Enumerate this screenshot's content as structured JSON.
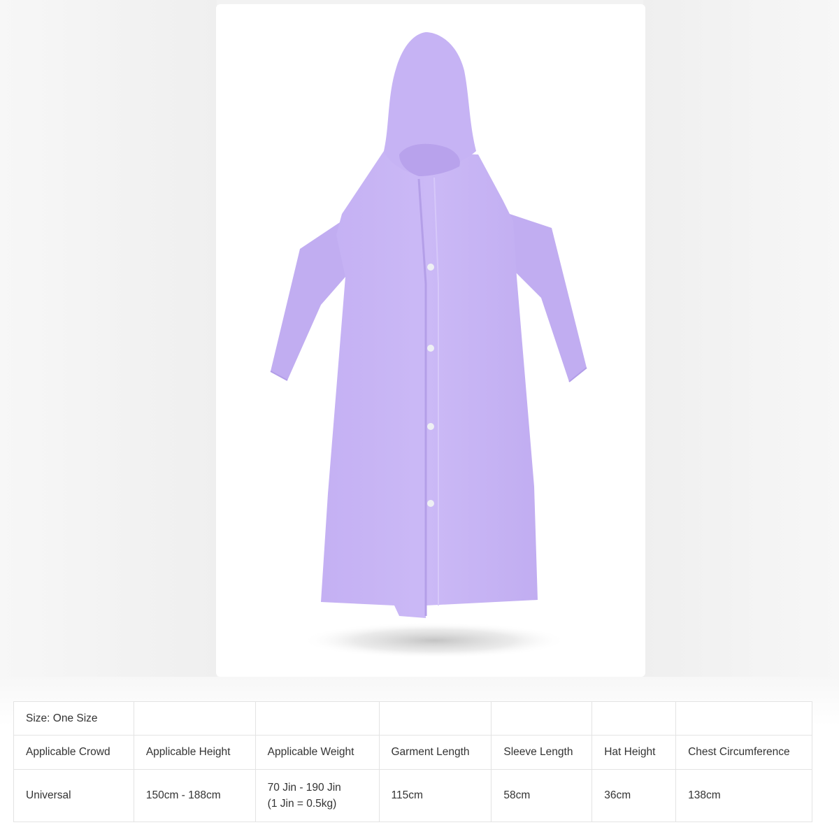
{
  "product": {
    "image_icon": "purple-hooded-raincoat",
    "colors": {
      "coat": "#c7b4f4",
      "coat_shade": "#b29de8",
      "button": "#eef0f4"
    }
  },
  "size_table": {
    "size_label": "Size: One Size",
    "headers": [
      "Applicable Crowd",
      "Applicable Height",
      "Applicable Weight",
      "Garment Length",
      "Sleeve Length",
      "Hat Height",
      "Chest Circumference"
    ],
    "values": {
      "crowd": "Universal",
      "height": "150cm - 188cm",
      "weight_line1": "70 Jin - 190 Jin",
      "weight_line2": "(1 Jin = 0.5kg)",
      "garment_length": "115cm",
      "sleeve_length": "58cm",
      "hat_height": "36cm",
      "chest": "138cm"
    }
  }
}
